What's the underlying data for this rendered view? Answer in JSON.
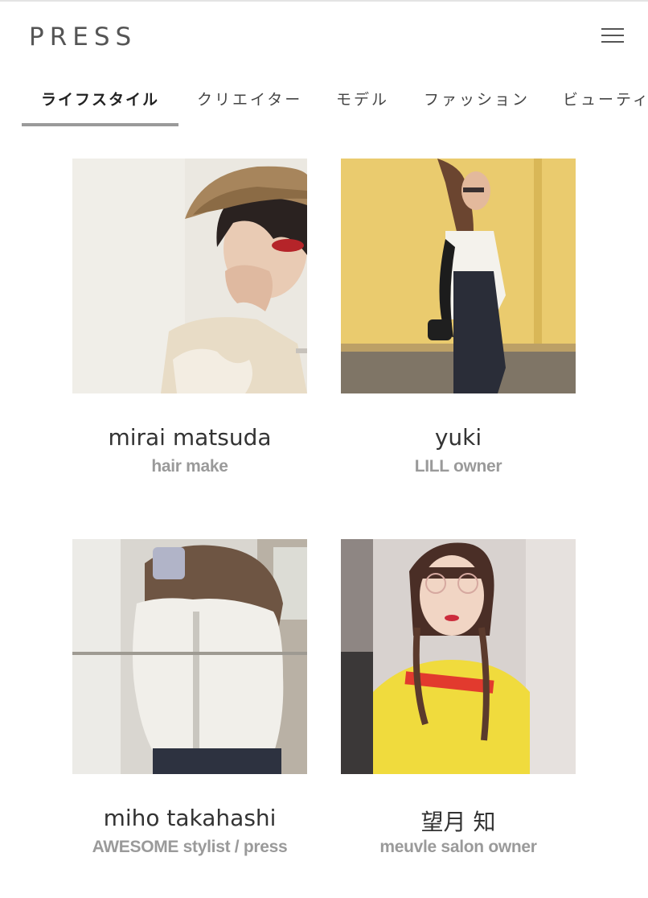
{
  "header": {
    "logo": "PRESS",
    "menu_icon": "hamburger-icon"
  },
  "tabs": [
    {
      "label": "ライフスタイル",
      "active": true
    },
    {
      "label": "クリエイター",
      "active": false
    },
    {
      "label": "モデル",
      "active": false
    },
    {
      "label": "ファッション",
      "active": false
    },
    {
      "label": "ビューティ",
      "active": false
    }
  ],
  "cards": [
    {
      "name": "mirai matsuda",
      "role": "hair make"
    },
    {
      "name": "yuki",
      "role": "LILL owner"
    },
    {
      "name": "miho takahashi",
      "role": "AWESOME stylist / press"
    },
    {
      "name": "望月 知",
      "role": "meuvle salon owner"
    }
  ]
}
